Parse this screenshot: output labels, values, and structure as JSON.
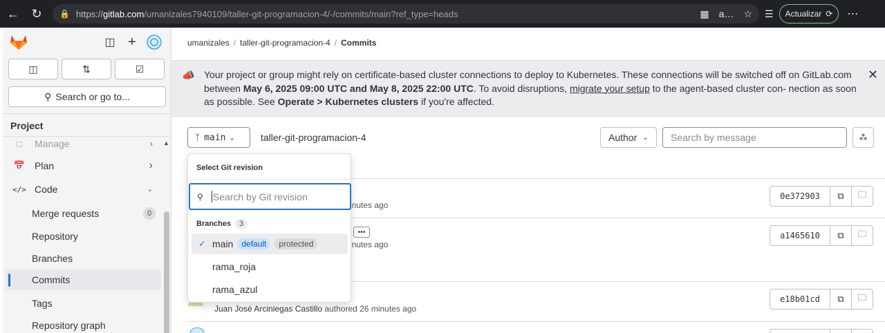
{
  "browser": {
    "url_prefix": "https://",
    "url_host": "gitlab.com",
    "url_rest": "/umanizales7940109/taller-git-programacion-4/-/commits/main?ref_type=heads",
    "update_label": "Actualizar"
  },
  "sidebar": {
    "search_label": "Search or go to...",
    "section_title": "Project",
    "items": [
      {
        "label": "Manage"
      },
      {
        "label": "Plan"
      },
      {
        "label": "Code"
      },
      {
        "label": "Merge requests",
        "badge": "0"
      },
      {
        "label": "Repository"
      },
      {
        "label": "Branches"
      },
      {
        "label": "Commits"
      },
      {
        "label": "Tags"
      },
      {
        "label": "Repository graph"
      }
    ]
  },
  "breadcrumb": {
    "items": [
      "umanizales",
      "taller-git-programacion-4",
      "Commits"
    ]
  },
  "banner": {
    "t1": "Your project or group might rely on certificate-based cluster connections to deploy to Kubernetes. These connections will be switched off on GitLab.com between ",
    "b1": "May 6, 2025 09:00 UTC and May 8, 2025 22:00 UTC",
    "t2": ". To avoid disruptions, ",
    "link": "migrate your setup",
    "t3": " to the agent-based cluster con- nection as soon as possible. See ",
    "b2": "Operate > Kubernetes clusters",
    "t4": " if you're affected."
  },
  "toolbar": {
    "branch": "main",
    "repo_name": "taller-git-programacion-4",
    "author_label": "Author",
    "search_placeholder": "Search by message"
  },
  "commits": [
    {
      "meta": "inutes ago",
      "sha": "0e372903"
    },
    {
      "meta": "inutes ago",
      "sha": "a1465610"
    },
    {
      "author": "Juan José Arciniegas Castillo",
      "meta": " authored 26 minutes ago",
      "sha": "e18b01cd"
    }
  ],
  "dropdown": {
    "title": "Select Git revision",
    "search_placeholder": "Search by Git revision",
    "section_label": "Branches",
    "section_count": "3",
    "branches": [
      {
        "name": "main",
        "tags": [
          "default",
          "protected"
        ],
        "selected": true
      },
      {
        "name": "rama_roja"
      },
      {
        "name": "rama_azul"
      }
    ]
  },
  "colors": {
    "accent": "#1f75cb",
    "logo_orange": "#e24329"
  }
}
